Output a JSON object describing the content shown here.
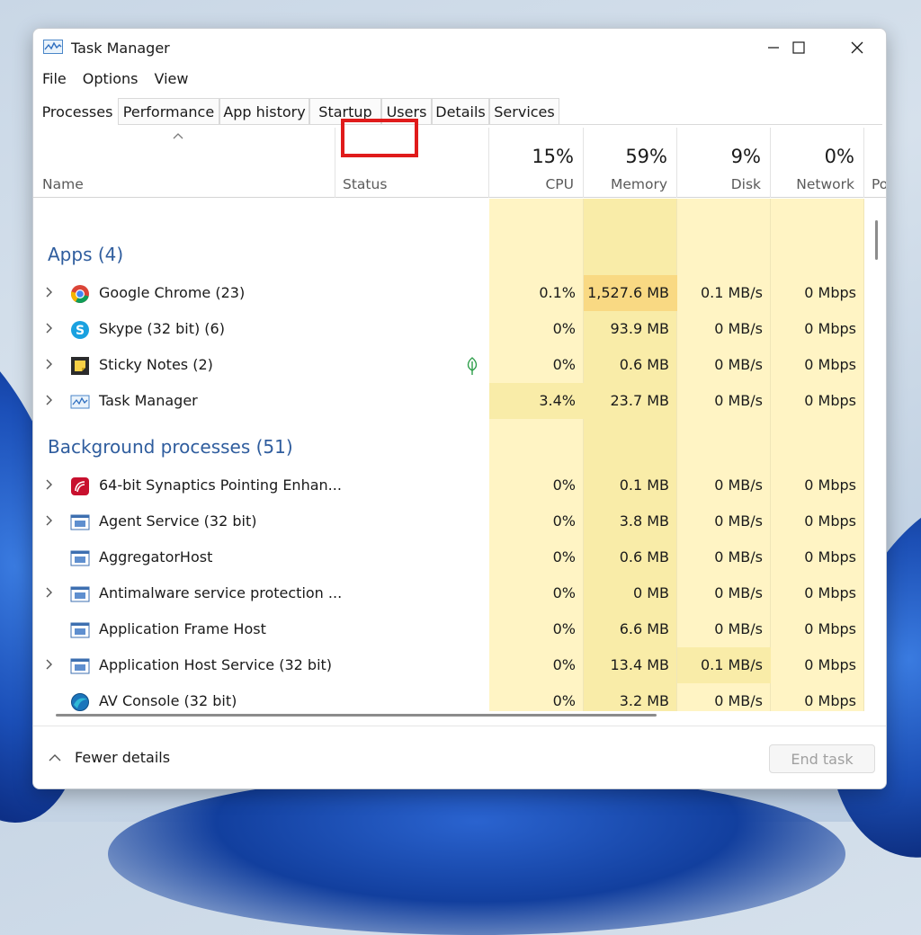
{
  "window": {
    "title": "Task Manager"
  },
  "menu": [
    "File",
    "Options",
    "View"
  ],
  "tabs": [
    "Processes",
    "Performance",
    "App history",
    "Startup",
    "Users",
    "Details",
    "Services"
  ],
  "header": {
    "name_label": "Name",
    "status_label": "Status",
    "cpu": {
      "percent": "15%",
      "label": "CPU"
    },
    "memory": {
      "percent": "59%",
      "label": "Memory"
    },
    "disk": {
      "percent": "9%",
      "label": "Disk"
    },
    "network": {
      "percent": "0%",
      "label": "Network"
    },
    "power": {
      "label": "Po"
    }
  },
  "sections": {
    "apps": "Apps (4)",
    "background": "Background processes (51)"
  },
  "apps": [
    {
      "name": "Google Chrome (23)",
      "cpu": "0.1%",
      "memory": "1,527.6 MB",
      "disk": "0.1 MB/s",
      "network": "0 Mbps",
      "icon": "chrome-icon"
    },
    {
      "name": "Skype (32 bit) (6)",
      "cpu": "0%",
      "memory": "93.9 MB",
      "disk": "0 MB/s",
      "network": "0 Mbps",
      "icon": "skype-icon"
    },
    {
      "name": "Sticky Notes (2)",
      "cpu": "0%",
      "memory": "0.6 MB",
      "disk": "0 MB/s",
      "network": "0 Mbps",
      "icon": "sticky-notes-icon",
      "status_icon": "leaf-icon"
    },
    {
      "name": "Task Manager",
      "cpu": "3.4%",
      "memory": "23.7 MB",
      "disk": "0 MB/s",
      "network": "0 Mbps",
      "icon": "task-manager-icon"
    }
  ],
  "background": [
    {
      "name": "64-bit Synaptics Pointing Enhan...",
      "cpu": "0%",
      "memory": "0.1 MB",
      "disk": "0 MB/s",
      "network": "0 Mbps",
      "icon": "synaptics-icon"
    },
    {
      "name": "Agent Service (32 bit)",
      "cpu": "0%",
      "memory": "3.8 MB",
      "disk": "0 MB/s",
      "network": "0 Mbps",
      "icon": "service-icon"
    },
    {
      "name": "AggregatorHost",
      "cpu": "0%",
      "memory": "0.6 MB",
      "disk": "0 MB/s",
      "network": "0 Mbps",
      "icon": "service-icon"
    },
    {
      "name": "Antimalware service protection ...",
      "cpu": "0%",
      "memory": "0 MB",
      "disk": "0 MB/s",
      "network": "0 Mbps",
      "icon": "service-icon"
    },
    {
      "name": "Application Frame Host",
      "cpu": "0%",
      "memory": "6.6 MB",
      "disk": "0 MB/s",
      "network": "0 Mbps",
      "icon": "service-icon"
    },
    {
      "name": "Application Host Service (32 bit)",
      "cpu": "0%",
      "memory": "13.4 MB",
      "disk": "0.1 MB/s",
      "network": "0 Mbps",
      "icon": "service-icon"
    },
    {
      "name": "AV Console (32 bit)",
      "cpu": "0%",
      "memory": "3.2 MB",
      "disk": "0 MB/s",
      "network": "0 Mbps",
      "icon": "av-console-icon"
    }
  ],
  "footer": {
    "fewer_details": "Fewer details",
    "end_task": "End task"
  },
  "colors": {
    "heat_light": "#fff4c4",
    "heat_medium": "#f9eca8",
    "heat_high": "#f9d983",
    "highlight": "#e01b1b",
    "section_text": "#2f5d9e"
  }
}
